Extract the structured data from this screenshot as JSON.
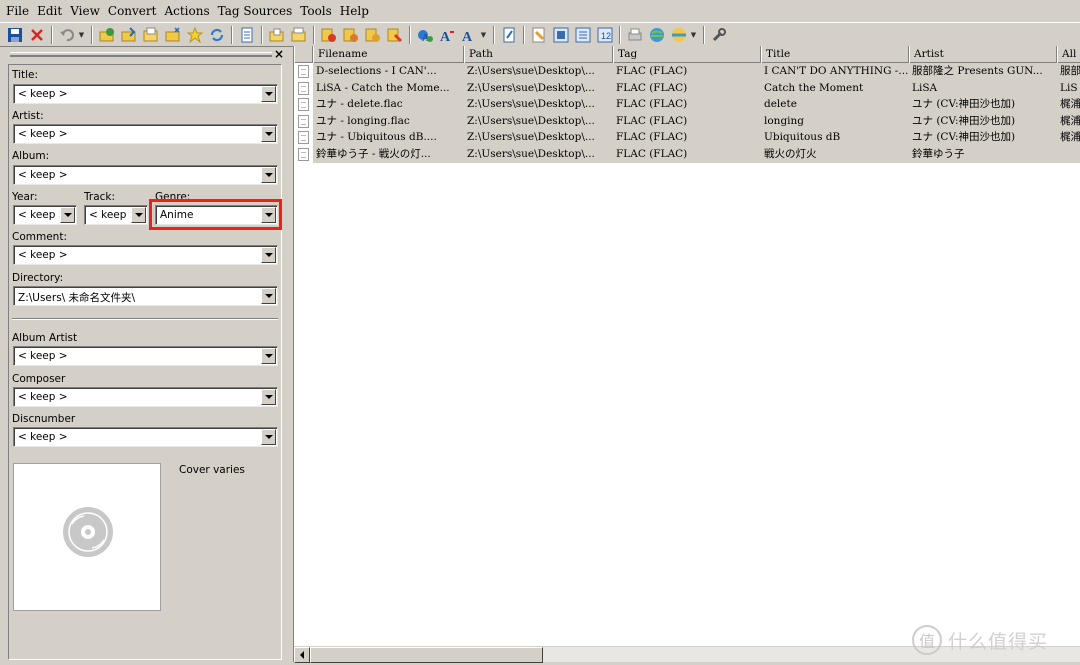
{
  "menu": [
    "File",
    "Edit",
    "View",
    "Convert",
    "Actions",
    "Tag Sources",
    "Tools",
    "Help"
  ],
  "toolbar_icons": [
    "save-icon",
    "remove-tag-icon",
    "undo-icon",
    "change-directory-icon",
    "add-directory-icon",
    "open-folder-icon",
    "add-folder-icon",
    "favorites-star-icon",
    "refresh-icon",
    "select-all-icon",
    "copy-tag-icon",
    "paste-tag-icon",
    "tag-to-filename-icon",
    "filename-to-tag-icon",
    "text-file-to-tag-icon",
    "tag-to-tag-icon",
    "actions-icon",
    "case-conversion-icon",
    "font-case-icon",
    "extended-tags-icon",
    "export-icon",
    "import-icon",
    "playlist-icon",
    "numbering-wizard-icon",
    "print-icon",
    "web-sources-icon",
    "discogs-icon",
    "tools-wrench-icon"
  ],
  "panel": {
    "close_label": "×",
    "fields": {
      "title": {
        "label": "Title:",
        "value": "< keep >"
      },
      "artist": {
        "label": "Artist:",
        "value": "< keep >"
      },
      "album": {
        "label": "Album:",
        "value": "< keep >"
      },
      "year": {
        "label": "Year:",
        "value": "< keep >"
      },
      "track": {
        "label": "Track:",
        "value": "< keep >"
      },
      "genre": {
        "label": "Genre:",
        "value": "Anime"
      },
      "comment": {
        "label": "Comment:",
        "value": "< keep >"
      },
      "directory": {
        "label": "Directory:",
        "value": "Z:\\Users\\                   未命名文件夹\\"
      },
      "album_artist": {
        "label": "Album Artist",
        "value": "< keep >"
      },
      "composer": {
        "label": "Composer",
        "value": "< keep >"
      },
      "discnumber": {
        "label": "Discnumber",
        "value": "< keep >"
      }
    },
    "cover_text": "Cover varies"
  },
  "grid": {
    "columns": [
      "Filename",
      "Path",
      "Tag",
      "Title",
      "Artist",
      "All"
    ],
    "rows": [
      [
        "D-selections - I CAN'...",
        "Z:\\Users\\sue\\Desktop\\...",
        "FLAC (FLAC)",
        "I CAN'T DO ANYTHING -...",
        "服部隆之 Presents GUN...",
        "服部"
      ],
      [
        "LiSA - Catch the Mome...",
        "Z:\\Users\\sue\\Desktop\\...",
        "FLAC (FLAC)",
        "Catch the Moment",
        "LiSA",
        "LiS"
      ],
      [
        "ユナ - delete.flac",
        "Z:\\Users\\sue\\Desktop\\...",
        "FLAC (FLAC)",
        "delete",
        "ユナ (CV:神田沙也加)",
        "梶浦"
      ],
      [
        "ユナ - longing.flac",
        "Z:\\Users\\sue\\Desktop\\...",
        "FLAC (FLAC)",
        "longing",
        "ユナ (CV:神田沙也加)",
        "梶浦"
      ],
      [
        "ユナ - Ubiquitous dB....",
        "Z:\\Users\\sue\\Desktop\\...",
        "FLAC (FLAC)",
        "Ubiquitous dB",
        "ユナ (CV:神田沙也加)",
        "梶浦"
      ],
      [
        "鈴華ゆう子 - 戦火の灯...",
        "Z:\\Users\\sue\\Desktop\\...",
        "FLAC (FLAC)",
        "戦火の灯火",
        "鈴華ゆう子",
        ""
      ]
    ]
  },
  "watermark": {
    "badge": "值",
    "text": "什么值得买"
  }
}
